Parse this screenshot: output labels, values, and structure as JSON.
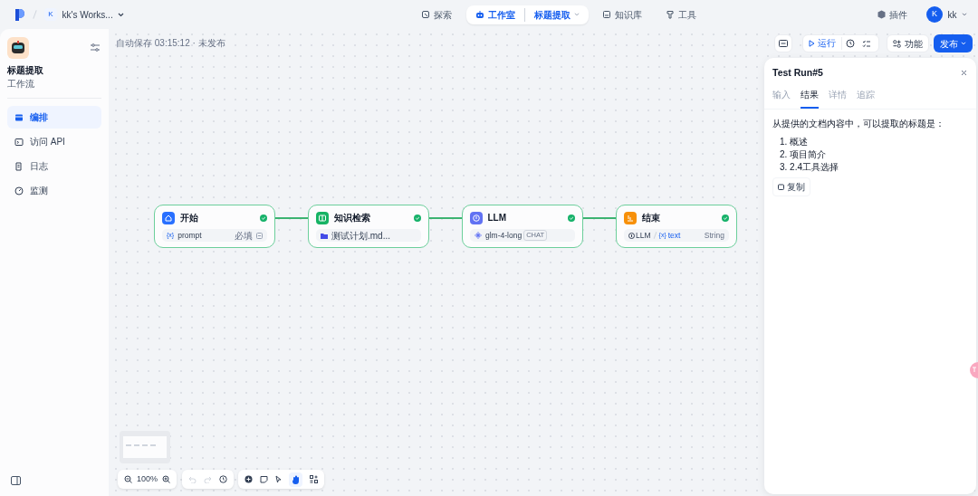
{
  "topbar": {
    "workspace": {
      "initial": "K",
      "name": "kk's Works..."
    },
    "nav": [
      {
        "label": "探索",
        "selected": false
      },
      {
        "label": "工作室",
        "selected": true,
        "sub": "标题提取"
      },
      {
        "label": "知识库",
        "selected": false
      },
      {
        "label": "工具",
        "selected": false
      }
    ],
    "plugins": "插件",
    "user": {
      "initial": "K",
      "name": "kk"
    }
  },
  "app": {
    "name": "标题提取",
    "type": "工作流"
  },
  "sidebar": {
    "items": [
      {
        "label": "编排",
        "selected": true
      },
      {
        "label": "访问 API",
        "selected": false
      },
      {
        "label": "日志",
        "selected": false
      },
      {
        "label": "监测",
        "selected": false
      }
    ]
  },
  "canvas": {
    "autosave": "自动保存 03:15:12 · 未发布",
    "run": "运行",
    "features": "功能",
    "publish": "发布",
    "zoom": "100%",
    "nodes": [
      {
        "title": "开始",
        "kind": "start",
        "color": "#2970ff",
        "done": true,
        "var_mark": "{x}",
        "text": "prompt",
        "note": "必填"
      },
      {
        "title": "知识检索",
        "kind": "knowledge",
        "color": "#16b364",
        "done": true,
        "text": "测试计划.md..."
      },
      {
        "title": "LLM",
        "kind": "llm",
        "color": "#6172f3",
        "done": true,
        "text": "glm-4-long",
        "tag": "CHAT"
      },
      {
        "title": "结束",
        "kind": "end",
        "color": "#f79009",
        "done": true,
        "source": "LLM",
        "var_mark": "{x}",
        "text": "text",
        "note": "String"
      }
    ]
  },
  "panel": {
    "title": "Test Run#5",
    "tabs": [
      {
        "label": "输入",
        "selected": false
      },
      {
        "label": "结果",
        "selected": true
      },
      {
        "label": "详情",
        "selected": false
      },
      {
        "label": "追踪",
        "selected": false
      }
    ],
    "intro": "从提供的文档内容中，可以提取的标题是：",
    "list": [
      "1. 概述",
      "2. 项目简介",
      "3. 2.4工具选择"
    ],
    "copy": "复制"
  }
}
